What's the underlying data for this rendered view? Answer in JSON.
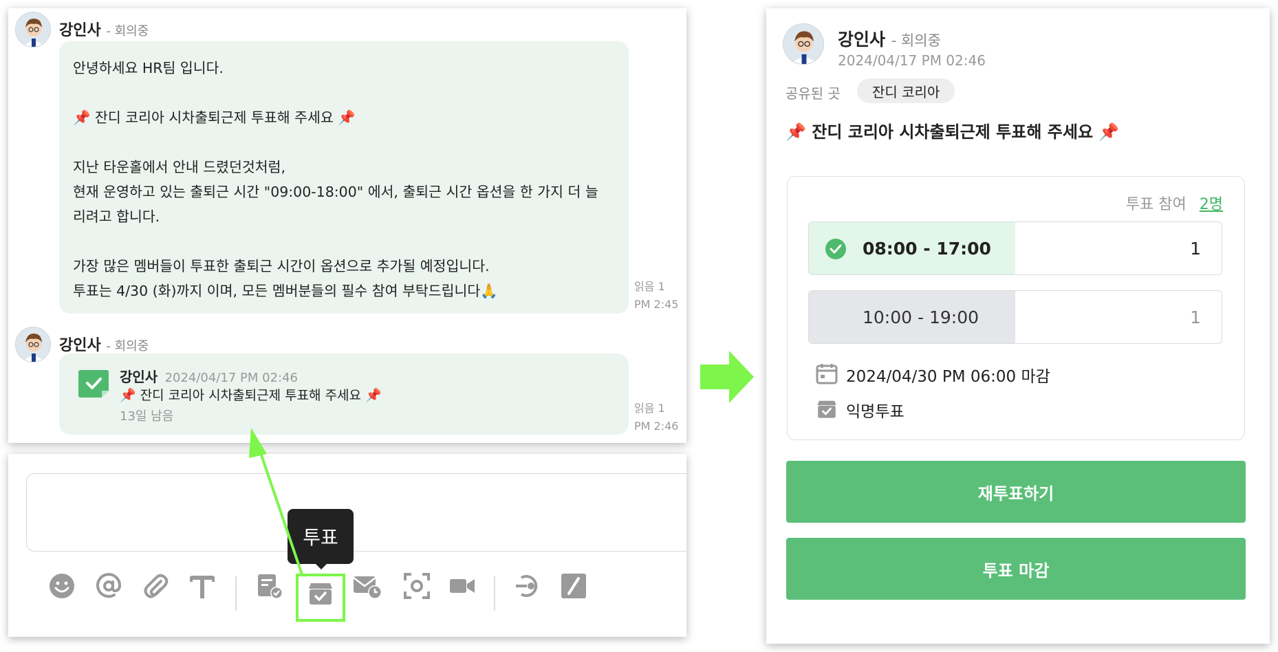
{
  "chat": {
    "messages": [
      {
        "sender": "강인사",
        "status": "- 회의중",
        "lines": [
          "안녕하세요 HR팀 입니다.",
          "📌 잔디 코리아 시차출퇴근제 투표해 주세요 📌",
          "지난 타운홀에서 안내 드렸던것처럼,",
          "현재 운영하고 있는 출퇴근 시간 \"09:00-18:00\" 에서, 출퇴근 시간 옵션을 한 가지 더 늘",
          "리려고 합니다.",
          "가장 많은 멤버들이 투표한 출퇴근 시간이 옵션으로 추가될 예정입니다.",
          "투표는 4/30 (화)까지 이며, 모든 멤버분들의 필수 참여 부탁드립니다🙏"
        ],
        "read": "읽음 1",
        "time": "PM 2:45"
      },
      {
        "sender": "강인사",
        "status": "- 회의중",
        "poll_card": {
          "author": "강인사",
          "date": "2024/04/17 PM 02:46",
          "title": "📌 잔디 코리아 시차출퇴근제 투표해 주세요 📌",
          "remaining": "13일 남음"
        },
        "read": "읽음 1",
        "time": "PM 2:46"
      }
    ]
  },
  "toolbar": {
    "tooltip": "투표",
    "icons": [
      "emoji-icon",
      "mention-icon",
      "attach-icon",
      "text-format-icon",
      "form-check-icon",
      "vote-box-icon",
      "scheduled-mail-icon",
      "screen-capture-icon",
      "video-call-icon",
      "integration-icon",
      "slash-command-icon"
    ]
  },
  "poll": {
    "author": "강인사",
    "status": "- 회의중",
    "date": "2024/04/17 PM 02:46",
    "shared_label": "공유된 곳",
    "shared_chip": "잔디 코리아",
    "title": "📌 잔디 코리아 시차출퇴근제 투표해 주세요 📌",
    "participants_label": "투표 참여",
    "participants_value": "2명",
    "options": [
      {
        "label": "08:00 - 17:00",
        "count": "1",
        "share": 0.5,
        "selected": true
      },
      {
        "label": "10:00 - 19:00",
        "count": "1",
        "share": 0.5,
        "selected": false
      }
    ],
    "deadline": "2024/04/30 PM 06:00 마감",
    "anonymous": "익명투표",
    "revote_button": "재투표하기",
    "close_button": "투표 마감"
  },
  "colors": {
    "accent_green": "#5bbf79",
    "bubble_bg": "#ebf4ef",
    "selected_fill": "#e2f6ea",
    "unselected_fill": "#e4e6ea",
    "arrow_green": "#7ef54b"
  }
}
